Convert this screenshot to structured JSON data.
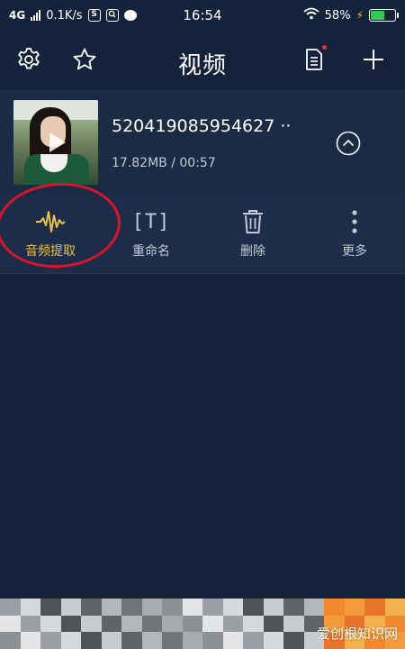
{
  "status_bar": {
    "network": "4G",
    "speed": "0.1K/s",
    "app_icon_1": "S",
    "time": "16:54",
    "battery": "58%",
    "battery_level": 0.58
  },
  "header": {
    "title": "视频",
    "icons": [
      "gear-icon",
      "star-icon",
      "document-icon",
      "plus-icon"
    ]
  },
  "video": {
    "name": "520419085954627 ··",
    "meta": "17.82MB / 00:57"
  },
  "actions": [
    {
      "label": "音频提取",
      "icon": "waveform-icon",
      "active": true
    },
    {
      "label": "重命名",
      "icon": "rename-icon",
      "glyph": "[T]"
    },
    {
      "label": "删除",
      "icon": "trash-icon"
    },
    {
      "label": "更多",
      "icon": "more-vertical-icon"
    }
  ],
  "colors": {
    "background": "#14223b",
    "card": "#1b2a45",
    "accent": "#e8c24a",
    "highlight": "#d8162b"
  },
  "watermark": "爱创根知识网"
}
